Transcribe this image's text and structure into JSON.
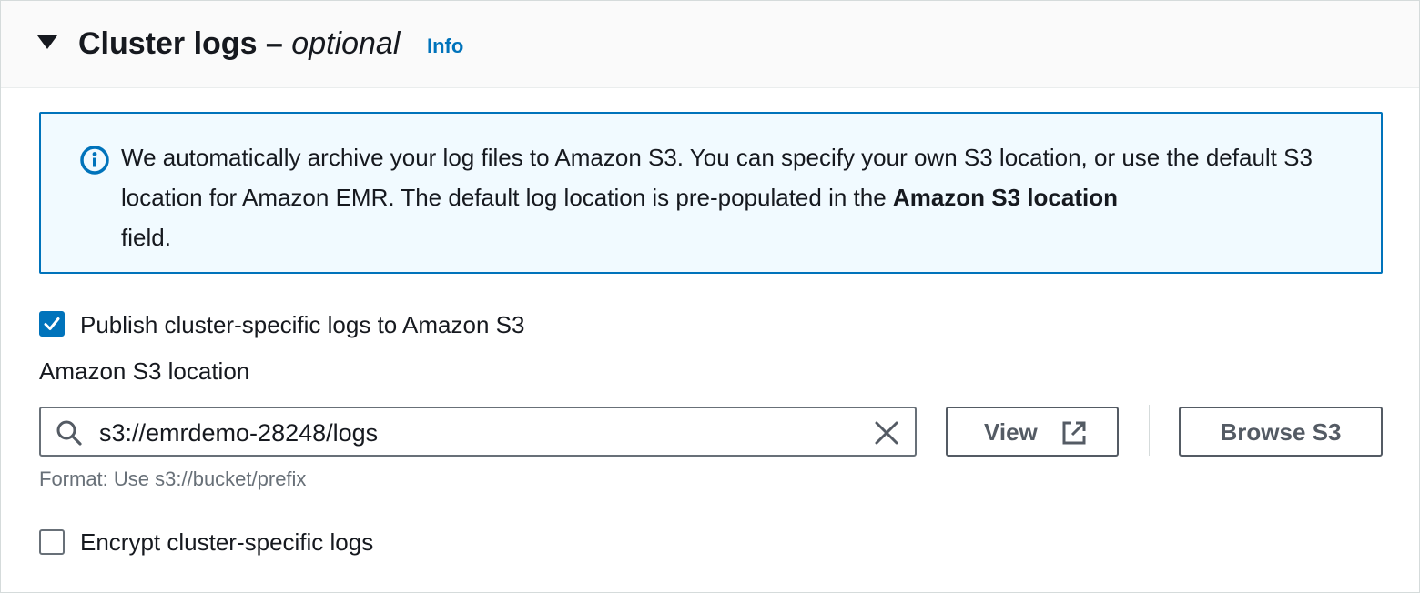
{
  "header": {
    "title": "Cluster logs –",
    "title_optional": "optional",
    "info_link": "Info"
  },
  "alert": {
    "text_before": "We automatically archive your log files to Amazon S3. You can specify your own S3 location, or use the default S3 location for Amazon EMR. The default log location is pre-populated in the",
    "text_bold": "Amazon S3 location",
    "text_after": "field.",
    "icon": "info-circle-icon"
  },
  "publish_checkbox": {
    "label": "Publish cluster-specific logs to Amazon S3",
    "checked": true
  },
  "s3_location": {
    "label": "Amazon S3 location",
    "value": "s3://emrdemo-28248/logs",
    "hint": "Format: Use s3://bucket/prefix"
  },
  "buttons": {
    "view": "View",
    "browse": "Browse S3"
  },
  "encrypt_checkbox": {
    "label": "Encrypt cluster-specific logs",
    "checked": false
  },
  "colors": {
    "accent": "#0073bb",
    "alert_bg": "#f1faff",
    "text": "#16191f",
    "muted": "#687078"
  }
}
